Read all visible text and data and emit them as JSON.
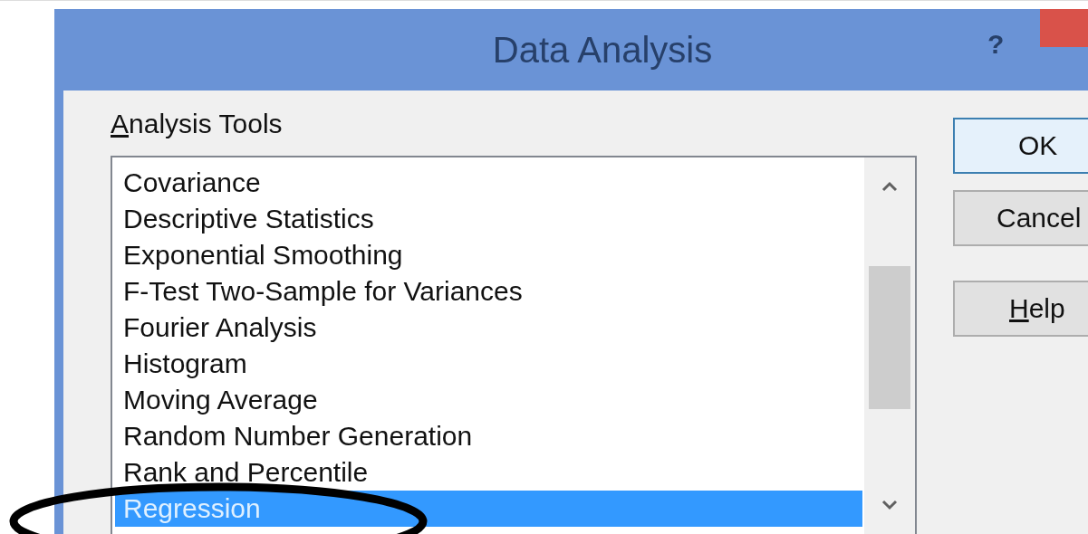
{
  "window": {
    "title": "Data Analysis",
    "help_glyph": "?"
  },
  "analysis_tools": {
    "label": "Analysis Tools",
    "items": [
      {
        "label": "Covariance",
        "selected": false
      },
      {
        "label": "Descriptive Statistics",
        "selected": false
      },
      {
        "label": "Exponential Smoothing",
        "selected": false
      },
      {
        "label": "F-Test Two-Sample for Variances",
        "selected": false
      },
      {
        "label": "Fourier Analysis",
        "selected": false
      },
      {
        "label": "Histogram",
        "selected": false
      },
      {
        "label": "Moving Average",
        "selected": false
      },
      {
        "label": "Random Number Generation",
        "selected": false
      },
      {
        "label": "Rank and Percentile",
        "selected": false
      },
      {
        "label": "Regression",
        "selected": true
      }
    ]
  },
  "buttons": [
    {
      "label": "OK",
      "access_key": false
    },
    {
      "label": "Cancel",
      "access_key": false
    },
    {
      "label": "Help",
      "access_key": true
    }
  ]
}
